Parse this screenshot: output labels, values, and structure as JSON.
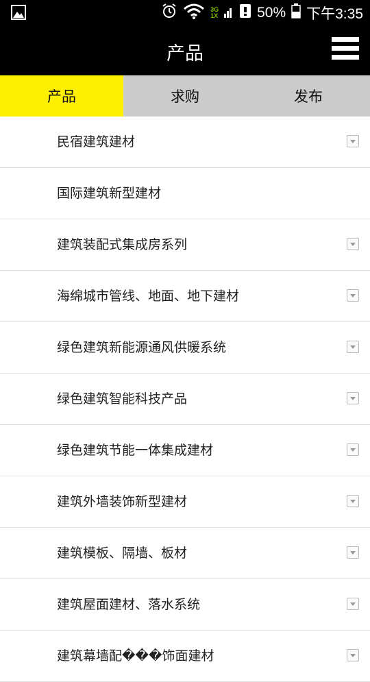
{
  "statusbar": {
    "network_top": "3G",
    "network_bottom": "1X",
    "battery": "50%",
    "time": "下午3:35"
  },
  "appbar": {
    "title": "产品"
  },
  "tabs": [
    {
      "label": "产品",
      "active": true
    },
    {
      "label": "求购",
      "active": false
    },
    {
      "label": "发布",
      "active": false
    }
  ],
  "categories": [
    {
      "label": "民宿建筑建材",
      "has_arrow": true
    },
    {
      "label": "国际建筑新型建材",
      "has_arrow": false
    },
    {
      "label": "建筑装配式集成房系列",
      "has_arrow": true
    },
    {
      "label": "海绵城市管线、地面、地下建材",
      "has_arrow": true
    },
    {
      "label": "绿色建筑新能源通风供暖系统",
      "has_arrow": true
    },
    {
      "label": "绿色建筑智能科技产品",
      "has_arrow": true
    },
    {
      "label": "绿色建筑节能一体集成建材",
      "has_arrow": true
    },
    {
      "label": "建筑外墙装饰新型建材",
      "has_arrow": true
    },
    {
      "label": "建筑模板、隔墙、板材",
      "has_arrow": true
    },
    {
      "label": "建筑屋面建材、落水系统",
      "has_arrow": true
    },
    {
      "label": "建筑幕墙配���饰面建材",
      "has_arrow": true
    }
  ]
}
